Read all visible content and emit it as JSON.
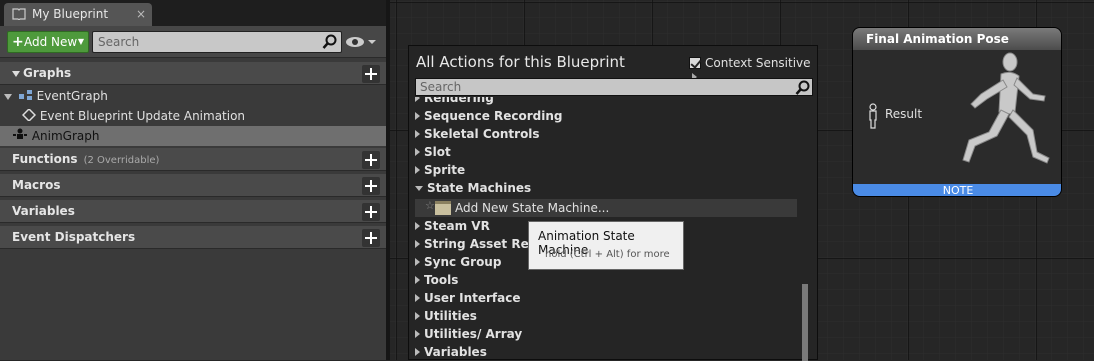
{
  "tab": {
    "title": "My Blueprint",
    "close": "×"
  },
  "toolbar": {
    "add_new": "Add New",
    "search_placeholder": "Search"
  },
  "sections": {
    "graphs": "Graphs",
    "event_graph": "EventGraph",
    "event_update": "Event Blueprint Update Animation",
    "anim_graph": "AnimGraph",
    "functions": "Functions",
    "functions_sub": "(2 Overridable)",
    "macros": "Macros",
    "variables": "Variables",
    "event_dispatchers": "Event Dispatchers"
  },
  "menu": {
    "title": "All Actions for this Blueprint",
    "context_sensitive": "Context Sensitive",
    "search_placeholder": "Search",
    "items": [
      "Rendering",
      "Sequence Recording",
      "Skeletal Controls",
      "Slot",
      "Sprite",
      "State Machines",
      "Steam VR",
      "String Asset Referen",
      "Sync Group",
      "Tools",
      "User Interface",
      "Utilities",
      "Utilities/ Array",
      "Variables"
    ],
    "highlighted": "Add New State Machine..."
  },
  "tooltip": {
    "title": "Animation State Machine",
    "hint": "hold (Ctrl + Alt) for more"
  },
  "node": {
    "title": "Final Animation Pose",
    "pin_label": "Result",
    "note": "NOTE"
  },
  "colors": {
    "accent_green": "#4e9a3c",
    "note_blue": "#4a8be6",
    "selection": "#6f6f6f"
  }
}
